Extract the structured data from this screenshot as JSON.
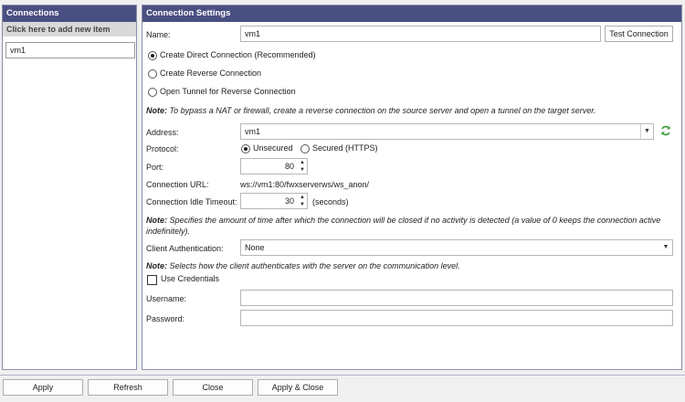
{
  "connections": {
    "header": "Connections",
    "add_new": "Click here to add new item",
    "items": [
      "vm1"
    ]
  },
  "settings": {
    "header": "Connection Settings",
    "name_label": "Name:",
    "name_value": "vm1",
    "test_button": "Test Connection",
    "conn_types": [
      {
        "label": "Create Direct Connection (Recommended)",
        "selected": true
      },
      {
        "label": "Create Reverse Connection",
        "selected": false
      },
      {
        "label": "Open Tunnel for Reverse Connection",
        "selected": false
      }
    ],
    "note1_bold": "Note:",
    "note1_text": " To bypass a NAT or firewall, create a reverse connection on the source server and open a tunnel on the target server.",
    "address_label": "Address:",
    "address_value": "vm1",
    "protocol_label": "Protocol:",
    "protocol_unsecured": "Unsecured",
    "protocol_secured": "Secured (HTTPS)",
    "protocol_selected": "Unsecured",
    "port_label": "Port:",
    "port_value": "80",
    "url_label": "Connection URL:",
    "url_value": "ws://vm1:80/fwxserverws/ws_anon/",
    "timeout_label": "Connection Idle Timeout:",
    "timeout_value": "30",
    "timeout_unit": "(seconds)",
    "note2_bold": "Note:",
    "note2_line1": " Specifies the amount of time after which the connection will be closed if no activity is detected (a value of 0 keeps the connection active",
    "note2_line2": "indefinitely).",
    "auth_label": "Client Authentication:",
    "auth_value": "None",
    "note3_bold": "Note:",
    "note3_text": " Selects how the client authenticates with the server on the communication level.",
    "use_credentials": "Use Credentials",
    "use_credentials_checked": false,
    "username_label": "Username:",
    "username_value": "",
    "password_label": "Password:",
    "password_value": ""
  },
  "footer": {
    "apply": "Apply",
    "refresh": "Refresh",
    "close": "Close",
    "apply_close": "Apply & Close"
  }
}
